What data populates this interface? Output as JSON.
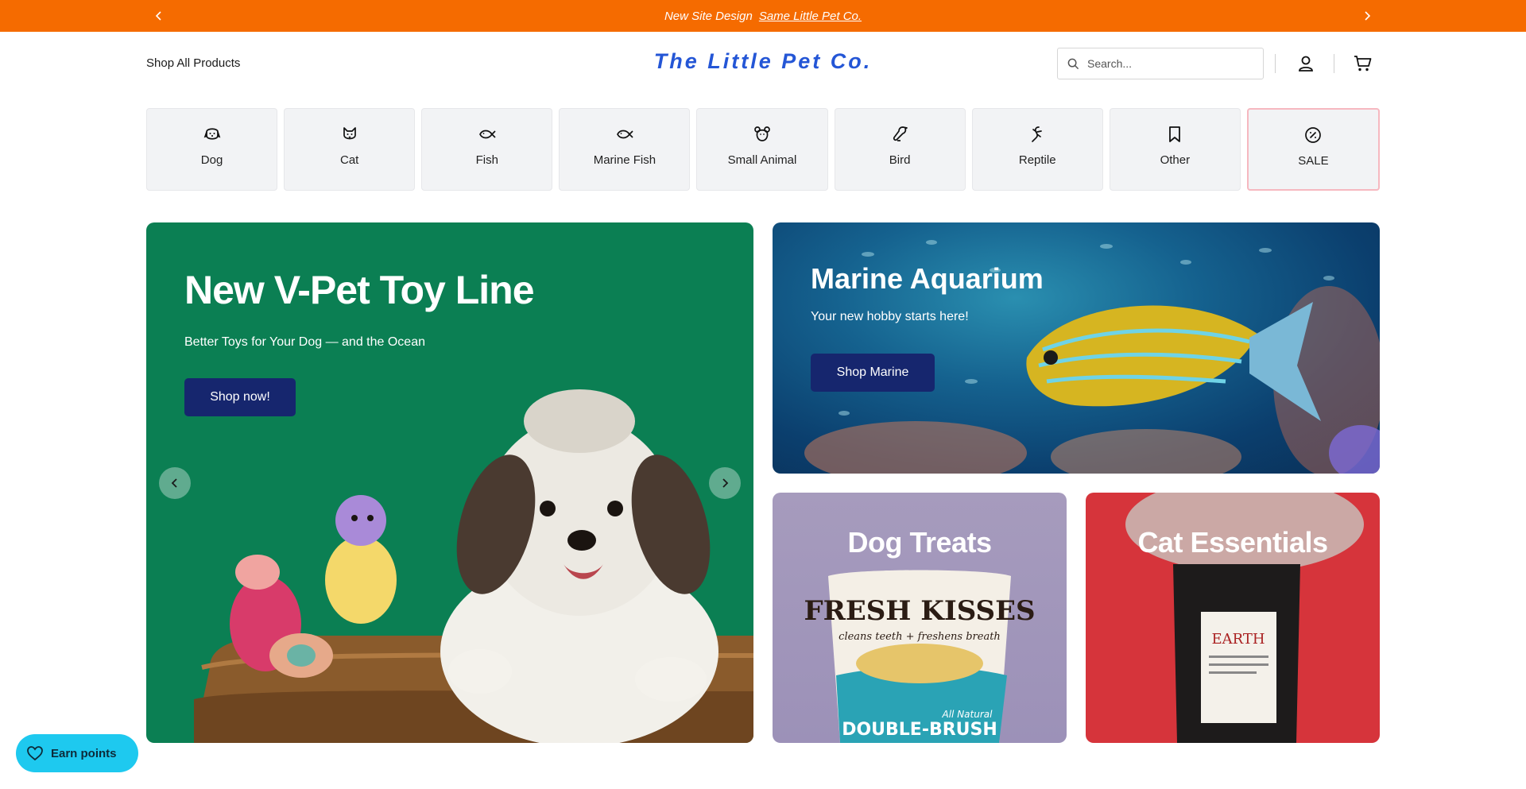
{
  "announcement": {
    "text": "New Site Design",
    "link": "Same Little Pet Co.",
    "bg": "#f56b00"
  },
  "header": {
    "shop_all": "Shop All Products",
    "logo": "The Little Pet Co.",
    "logo_color": "#2456d6",
    "search_placeholder": "Search...",
    "search_value": ""
  },
  "categories": [
    {
      "label": "Dog",
      "icon": "dog-icon"
    },
    {
      "label": "Cat",
      "icon": "cat-icon"
    },
    {
      "label": "Fish",
      "icon": "fish-icon"
    },
    {
      "label": "Marine Fish",
      "icon": "fish-icon"
    },
    {
      "label": "Small Animal",
      "icon": "hamster-icon"
    },
    {
      "label": "Bird",
      "icon": "bird-icon"
    },
    {
      "label": "Reptile",
      "icon": "lizard-icon"
    },
    {
      "label": "Other",
      "icon": "bookmark-icon"
    },
    {
      "label": "SALE",
      "icon": "percent-badge-icon"
    }
  ],
  "hero": {
    "title": "New V-Pet Toy Line",
    "subtitle": "Better Toys for Your Dog — and the Ocean",
    "button": "Shop now!",
    "bg": "#0b7f53"
  },
  "marine": {
    "title": "Marine Aquarium",
    "subtitle": "Your new hobby starts here!",
    "button": "Shop Marine"
  },
  "tiles": {
    "dog_treats": "Dog Treats",
    "cat_essentials": "Cat Essentials",
    "bag_brand_text": "FRESH KISSES",
    "bag_tagline": "cleans teeth + freshens breath",
    "bag_bottom": "DOUBLE-BRUSH",
    "bag_natural": "All Natural",
    "cat_bag_text": "EARTH"
  },
  "earn": {
    "label": "Earn points",
    "bg": "#1ec9ef"
  }
}
